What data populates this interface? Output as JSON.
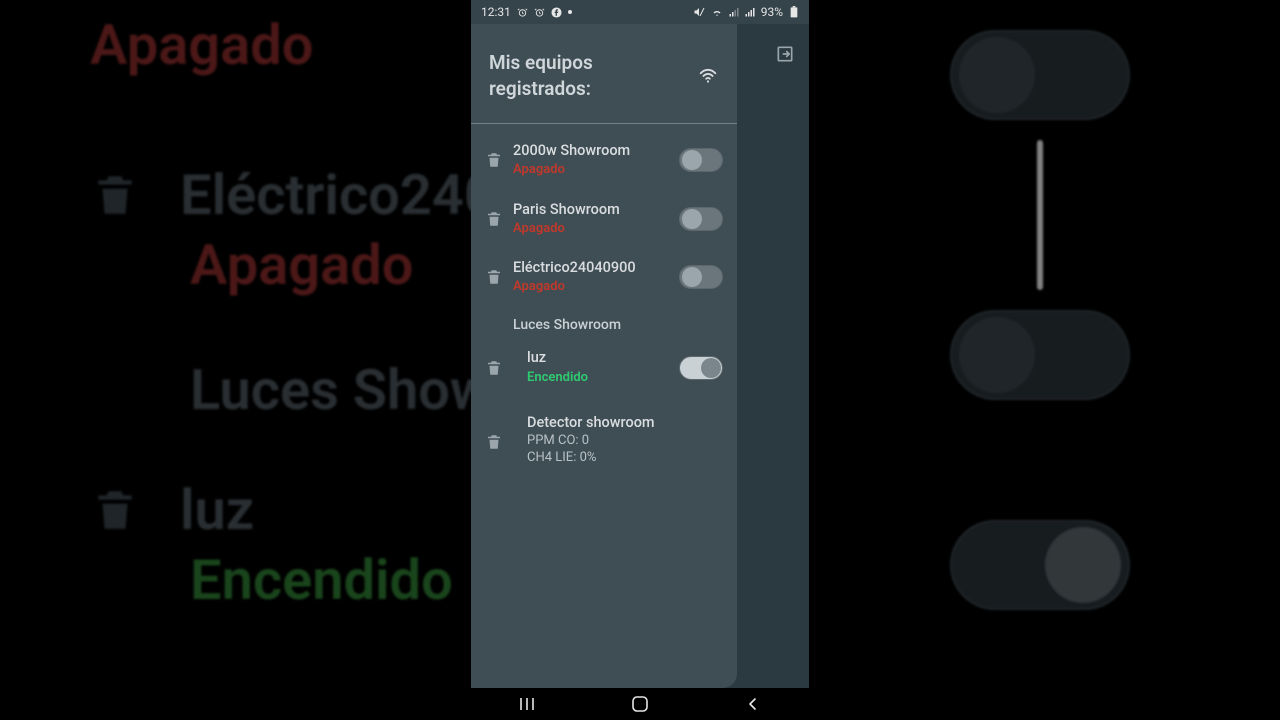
{
  "statusbar": {
    "time": "12:31",
    "battery": "93%"
  },
  "header": {
    "title_line1": "Mis equipos",
    "title_line2": "registrados:"
  },
  "status_labels": {
    "off": "Apagado",
    "on": "Encendido"
  },
  "devices": [
    {
      "name": "2000w Showroom",
      "status": "off",
      "has_toggle": true,
      "has_trash": true
    },
    {
      "name": "Paris Showroom",
      "status": "off",
      "has_toggle": true,
      "has_trash": true
    },
    {
      "name": "Eléctrico24040900",
      "status": "off",
      "has_toggle": true,
      "has_trash": true
    }
  ],
  "groups": [
    {
      "title": "Luces Showroom",
      "items": [
        {
          "name": "luz",
          "status": "on",
          "has_toggle": true,
          "has_trash": true
        }
      ]
    },
    {
      "title": "Detector showroom",
      "has_trash": true,
      "lines": [
        "PPM CO: 0",
        "CH4 LIE: 0%"
      ]
    }
  ],
  "bg": {
    "row0_status": "Apagado",
    "row1_name": "Eléctrico240",
    "row1_status": "Apagado",
    "row2_name": "Luces Show",
    "row3_name": "luz",
    "row3_status": "Encendido"
  }
}
